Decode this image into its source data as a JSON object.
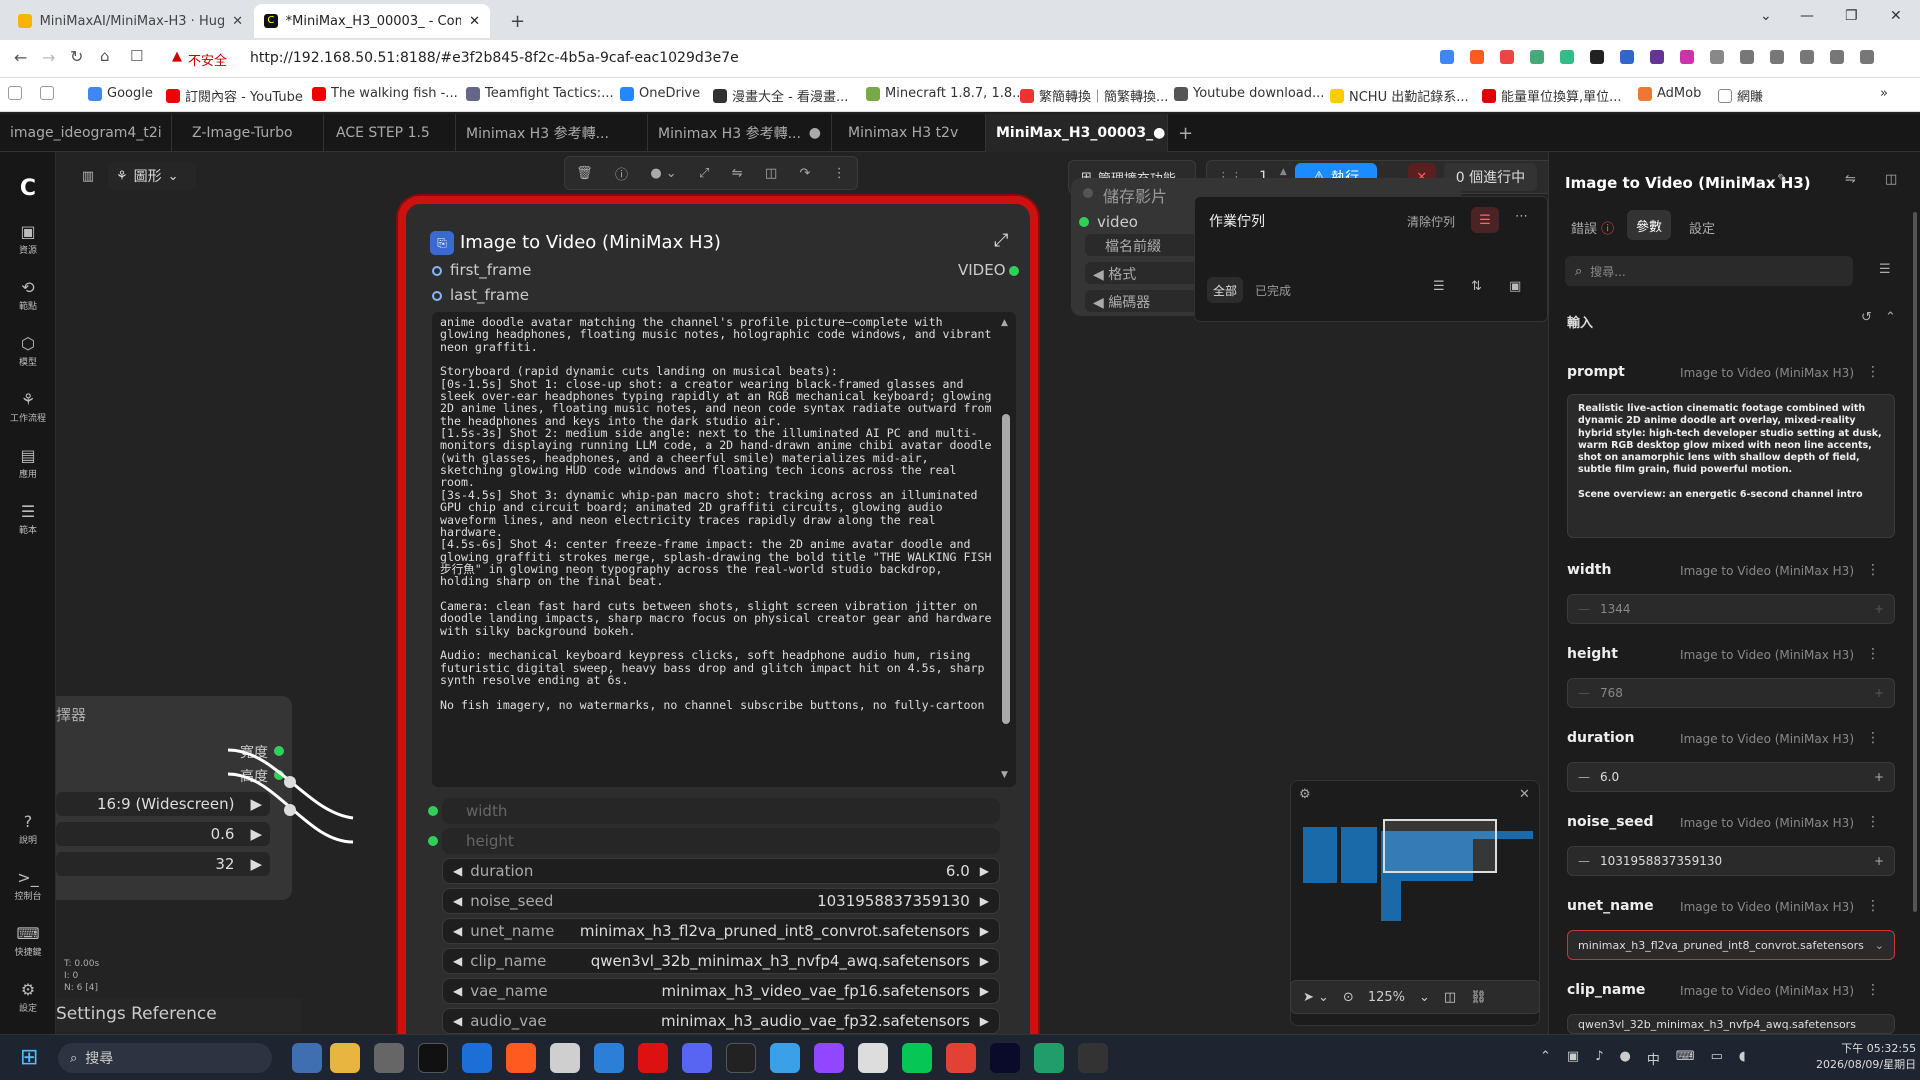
{
  "browser": {
    "tabs": [
      {
        "title": "MiniMaxAI/MiniMax-H3 · Hugging",
        "active": false
      },
      {
        "title": "*MiniMax_H3_00003_ - Comfy",
        "active": true
      }
    ],
    "security_label": "不安全",
    "url": "http://192.168.50.51:8188/#e3f2b845-8f2c-4b5a-9caf-eac1029d3e7e",
    "bookmarks": [
      "Google",
      "訂閱內容 - YouTube",
      "The walking fish -...",
      "Teamfight Tactics:...",
      "OneDrive",
      "漫畫大全 - 看漫畫...",
      "Minecraft 1.8.7, 1.8...",
      "繁簡轉換｜簡繁轉換...",
      "Youtube download...",
      "NCHU 出勤記錄系...",
      "能量單位換算,單位...",
      "AdMob",
      "網賺"
    ]
  },
  "app_tabs": [
    "image_ideogram4_t2i",
    "Z-Image-Turbo",
    "ACE STEP 1.5",
    "Minimax H3 参考轉...",
    "Minimax H3 参考轉...",
    "Minimax H3 t2v",
    "MiniMax_H3_00003_"
  ],
  "canvas_toolbar": {
    "view_mode": "圖形",
    "manage_extensions": "管理擴充功能",
    "queue_count": "1",
    "run_label": "執行",
    "running_label": "0 個進行中"
  },
  "sidebar": [
    "資源",
    "範點",
    "模型",
    "工作流程",
    "應用",
    "範本",
    "說明",
    "控制台",
    "快捷鍵",
    "設定"
  ],
  "node": {
    "title": "Image to Video (MiniMax H3)",
    "inputs": [
      "first_frame",
      "last_frame"
    ],
    "output": "VIDEO",
    "prompt_text": "anime doodle avatar matching the channel's profile picture—complete with glowing headphones, floating music notes, holographic code windows, and vibrant neon graffiti.\n\nStoryboard (rapid dynamic cuts landing on musical beats):\n[0s-1.5s] Shot 1: close-up shot: a creator wearing black-framed glasses and sleek over-ear headphones typing rapidly at an RGB mechanical keyboard; glowing 2D anime lines, floating music notes, and neon code syntax radiate outward from the headphones and keys into the dark studio air.\n[1.5s-3s] Shot 2: medium side angle: next to the illuminated AI PC and multi-monitors displaying running LLM code, a 2D hand-drawn anime chibi avatar doodle (with glasses, headphones, and a cheerful smile) materializes mid-air, sketching glowing HUD code windows and floating tech icons across the real room.\n[3s-4.5s] Shot 3: dynamic whip-pan macro shot: tracking across an illuminated GPU chip and circuit board; animated 2D graffiti circuits, glowing audio waveform lines, and neon electricity traces rapidly draw along the real hardware.\n[4.5s-6s] Shot 4: center freeze-frame impact: the 2D anime avatar doodle and glowing graffiti strokes merge, splash-drawing the bold title \"THE WALKING FISH 步行魚\" in glowing neon typography across the real-world studio backdrop, holding sharp on the final beat.\n\nCamera: clean fast hard cuts between shots, slight screen vibration jitter on doodle landing impacts, sharp macro focus on physical creator gear and hardware with silky background bokeh.\n\nAudio: mechanical keyboard keypress clicks, soft headphone audio hum, rising futuristic digital sweep, heavy bass drop and glitch impact hit on 4.5s, sharp synth resolve ending at 6s.\n\nNo fish imagery, no watermarks, no channel subscribe buttons, no fully-cartoon",
    "linked_widgets": [
      "width",
      "height"
    ],
    "widgets": [
      {
        "label": "duration",
        "value": "6.0"
      },
      {
        "label": "noise_seed",
        "value": "1031958837359130"
      },
      {
        "label": "unet_name",
        "value": "minimax_h3_fl2va_pruned_int8_convrot.safetensors"
      },
      {
        "label": "clip_name",
        "value": "qwen3vl_32b_minimax_h3_nvfp4_awq.safetensors"
      },
      {
        "label": "vae_name",
        "value": "minimax_h3_video_vae_fp16.safetensors"
      },
      {
        "label": "audio_vae",
        "value": "minimax_h3_audio_vae_fp32.safetensors"
      }
    ]
  },
  "save_node": {
    "title": "儲存影片",
    "input": "video",
    "widgets": [
      "檔名前綴",
      "格式",
      "編碼器"
    ]
  },
  "left_node": {
    "title": "擇器",
    "outputs": [
      "寬度",
      "高度"
    ],
    "widgets": [
      "16:9 (Widescreen)",
      "0.6",
      "32"
    ]
  },
  "queue_panel": {
    "title": "作業佇列",
    "clear": "清除佇列",
    "tabs": [
      "全部",
      "已完成"
    ]
  },
  "stats": [
    "T: 0.00s",
    "I: 0",
    "N: 6 [4]"
  ],
  "settings_ref": "Settings Reference",
  "zoom": "125%",
  "right_panel": {
    "title": "Image to Video (MiniMax H3)",
    "tabs": [
      "錯誤",
      "參數",
      "設定"
    ],
    "search_placeholder": "搜尋...",
    "section": "輸入",
    "prompt_label": "prompt",
    "node_ref": "Image to Video (MiniMax H3)",
    "prompt_preview": "Realistic live-action cinematic footage combined with dynamic 2D anime doodle art overlay, mixed-reality hybrid style: high-tech developer studio setting at dusk, warm RGB desktop glow mixed with neon line accents, shot on anamorphic lens with shallow depth of field, subtle film grain, fluid powerful motion.\n\nScene overview: an energetic 6-second channel intro",
    "fields": [
      {
        "label": "width",
        "value": "1344"
      },
      {
        "label": "height",
        "value": "768"
      },
      {
        "label": "duration",
        "value": "6.0"
      },
      {
        "label": "noise_seed",
        "value": "1031958837359130"
      },
      {
        "label": "unet_name",
        "value": "minimax_h3_fl2va_pruned_int8_convrot.safetensors"
      },
      {
        "label": "clip_name",
        "value": "qwen3vl_32b_minimax_h3_nvfp4_awq.safetensors"
      }
    ]
  },
  "taskbar": {
    "search": "搜尋",
    "time": "下午 05:32:55",
    "date": "2026/08/09/星期日"
  },
  "colors": {
    "accent": "#1a8cff",
    "node_border": "#cc1111",
    "link": "#2fd05a"
  }
}
